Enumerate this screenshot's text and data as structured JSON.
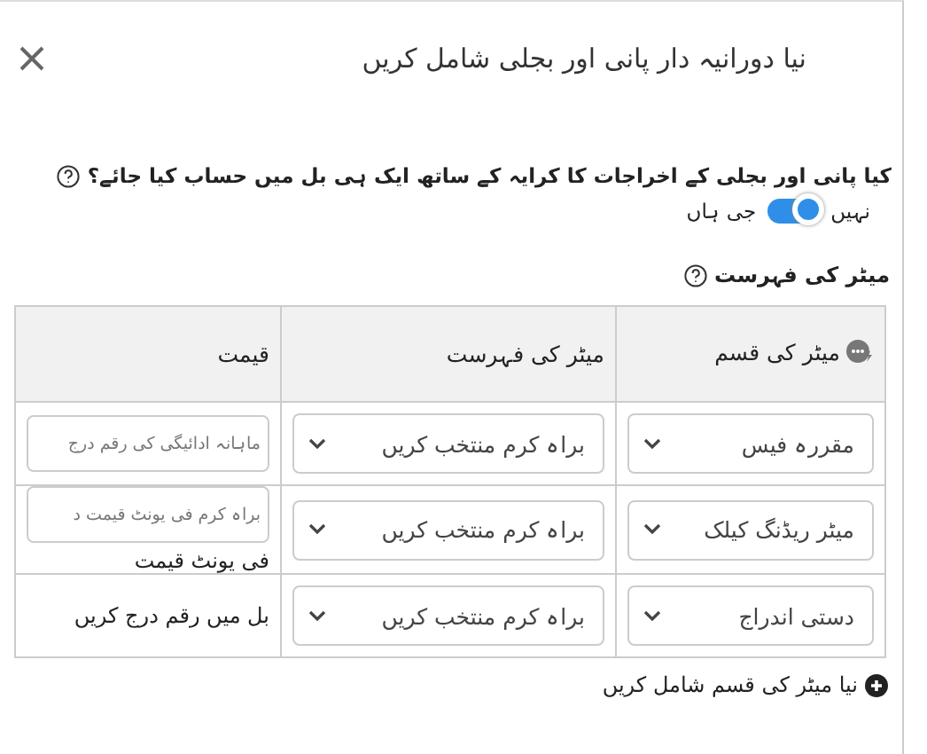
{
  "dialog": {
    "title": "نیا دورانیہ دار پانی اور بجلی شامل کریں"
  },
  "question": {
    "text": "کیا پانی اور بجلی کے اخراجات کا کرایہ کے ساتھ ایک ہی بل میں حساب کیا جائے؟",
    "toggle": {
      "off_label": "نہیں",
      "on_label": "جی ہاں",
      "on": true
    }
  },
  "meter_list": {
    "title": "میٹر کی فہرست",
    "table": {
      "columns": [
        "میٹر کی قسم",
        "میٹر کی فہرست",
        "قیمت"
      ],
      "rows": [
        {
          "type": "مقررہ فیس",
          "list": "براہ کرم منتخب کریں",
          "price": {
            "kind": "input",
            "placeholder": "ماہانہ ادائیگی کی رقم درج"
          }
        },
        {
          "type": "میٹر ریڈنگ کیلک",
          "list": "براہ کرم منتخب کریں",
          "price": {
            "kind": "input",
            "placeholder": "براہ کرم فی یونٹ قیمت د",
            "note": "فی یونٹ قیمت"
          }
        },
        {
          "type": "دستی اندراج",
          "list": "براہ کرم منتخب کریں",
          "price": {
            "kind": "text",
            "text": "بل میں رقم درج کریں"
          }
        }
      ]
    },
    "add_link": "نیا میٹر کی قسم شامل کریں"
  }
}
